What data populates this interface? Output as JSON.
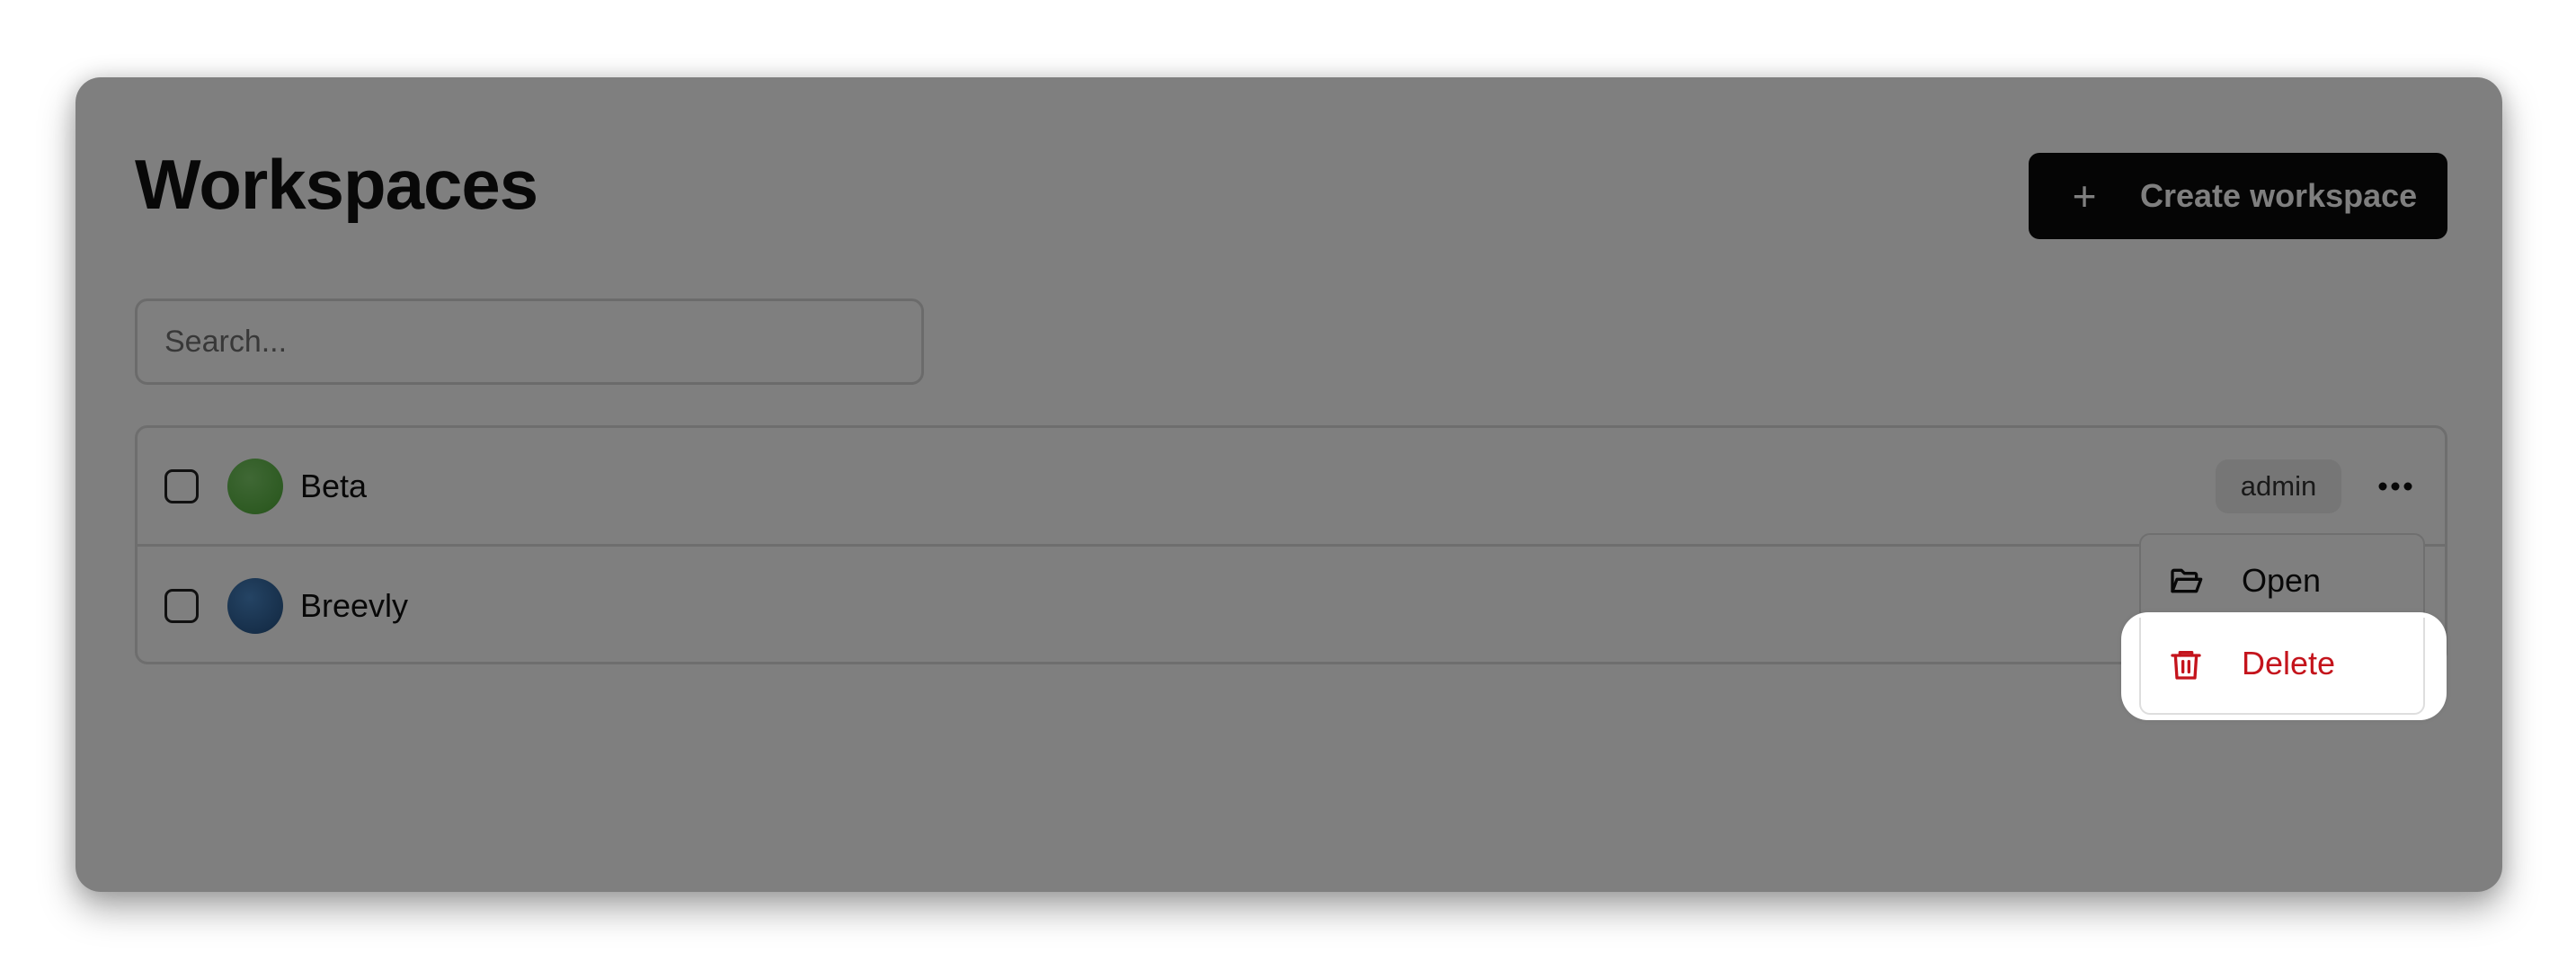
{
  "header": {
    "title": "Workspaces",
    "create_button_label": "Create workspace",
    "create_button_icon": "+"
  },
  "search": {
    "placeholder": "Search...",
    "value": ""
  },
  "workspaces": [
    {
      "name": "Beta",
      "role": "admin",
      "avatar_color": "#5cb545",
      "selected": false
    },
    {
      "name": "Breevly",
      "role": "",
      "avatar_color": "#2e5f95",
      "selected": false
    }
  ],
  "row_menu": {
    "open_label": "Open",
    "delete_label": "Delete"
  },
  "colors": {
    "accent": "#0a0a0a",
    "danger": "#c4141c"
  }
}
